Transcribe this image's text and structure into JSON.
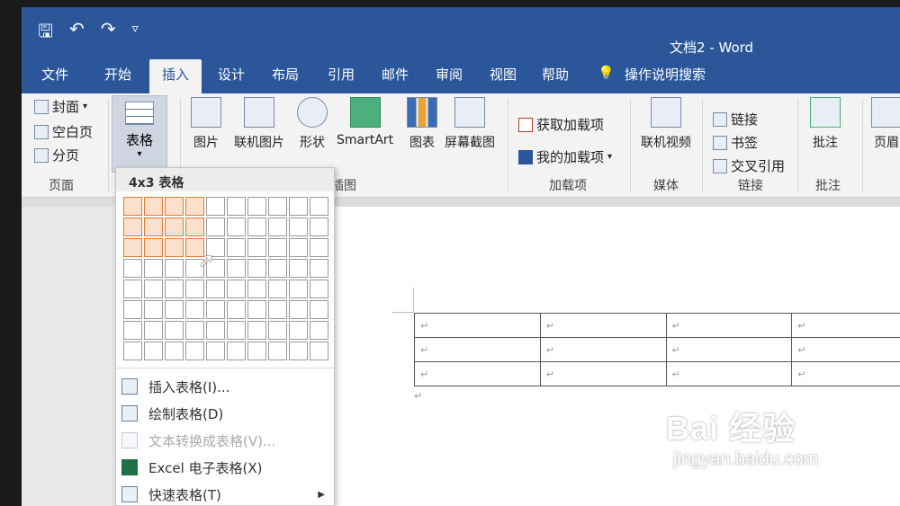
{
  "window": {
    "title": "文档2 - Word"
  },
  "qat": {
    "save_icon": "save-icon",
    "undo_icon": "undo-icon",
    "redo_icon": "redo-icon",
    "customize_icon": "chevron-down-icon"
  },
  "tabs": [
    "文件",
    "开始",
    "插入",
    "设计",
    "布局",
    "引用",
    "邮件",
    "审阅",
    "视图",
    "帮助"
  ],
  "active_tab": "插入",
  "tell_me": "操作说明搜索",
  "ribbon": {
    "pages_group": {
      "label": "页面",
      "cover": "封面",
      "blank": "空白页",
      "break": "分页"
    },
    "table_button": "表格",
    "illustrations": {
      "label": "插图",
      "picture": "图片",
      "online_picture": "联机图片",
      "shapes": "形状",
      "smartart": "SmartArt",
      "chart": "图表",
      "screenshot": "屏幕截图"
    },
    "addins": {
      "label": "加载项",
      "get": "获取加载项",
      "my": "我的加载项"
    },
    "media": {
      "label": "媒体",
      "video": "联机视频"
    },
    "links": {
      "label": "链接",
      "link": "链接",
      "bookmark": "书签",
      "crossref": "交叉引用"
    },
    "comments": {
      "label": "批注",
      "comment": "批注"
    },
    "header": {
      "label": "页眉"
    }
  },
  "table_dropdown": {
    "header": "4x3 表格",
    "selected_cols": 4,
    "selected_rows": 3,
    "menu": [
      {
        "label": "插入表格(I)...",
        "disabled": false
      },
      {
        "label": "绘制表格(D)",
        "disabled": false
      },
      {
        "label": "文本转换成表格(V)...",
        "disabled": true
      },
      {
        "label": "Excel 电子表格(X)",
        "disabled": false
      },
      {
        "label": "快速表格(T)",
        "disabled": false
      }
    ]
  },
  "document": {
    "para_mark": "↵"
  },
  "watermark": {
    "logo": "Bai 经验",
    "url": "jingyan.baidu.com"
  }
}
